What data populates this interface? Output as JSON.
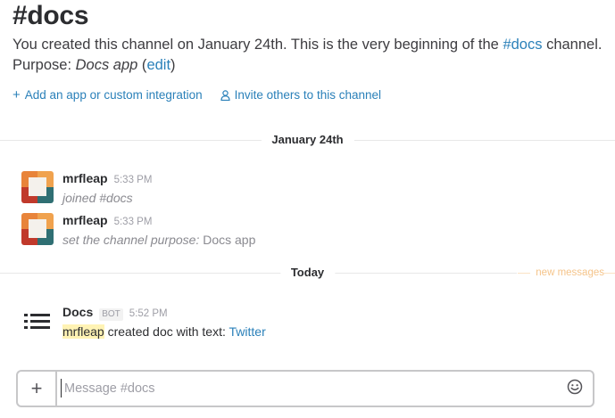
{
  "channel": {
    "title": "#docs",
    "intro_before": "You created this channel on January 24th. This is the very beginning of the ",
    "intro_channel_link": "#docs",
    "intro_after": " channel. Purpose: ",
    "purpose": "Docs app",
    "edit_open": " (",
    "edit_link": "edit",
    "edit_close": ")"
  },
  "actions": {
    "add_app": "Add an app or custom integration",
    "invite": "Invite others to this channel"
  },
  "dividers": {
    "first": "January 24th",
    "second": "Today",
    "new_messages": "new messages"
  },
  "messages": [
    {
      "sender": "mrfleap",
      "time": "5:33 PM",
      "text": "joined #docs"
    },
    {
      "sender": "mrfleap",
      "time": "5:33 PM",
      "text_italic": "set the channel purpose: ",
      "text_plain": "Docs app"
    },
    {
      "sender": "Docs",
      "badge": "BOT",
      "time": "5:52 PM",
      "mention": "mrfleap",
      "text_mid": " created doc with text: ",
      "link": "Twitter"
    }
  ],
  "composer": {
    "plus": "+",
    "placeholder": "Message #docs"
  },
  "colors": {
    "link": "#2a80b9",
    "new_messages": "#f5c48a",
    "highlight": "#fff3b4",
    "avatar_orange": "#e8843a",
    "avatar_red": "#c0392b",
    "avatar_teal": "#2f6f73"
  },
  "icons": {
    "add": "plus-icon",
    "invite": "person-icon",
    "bot_avatar": "list-icon",
    "emoji": "smiley-icon"
  }
}
